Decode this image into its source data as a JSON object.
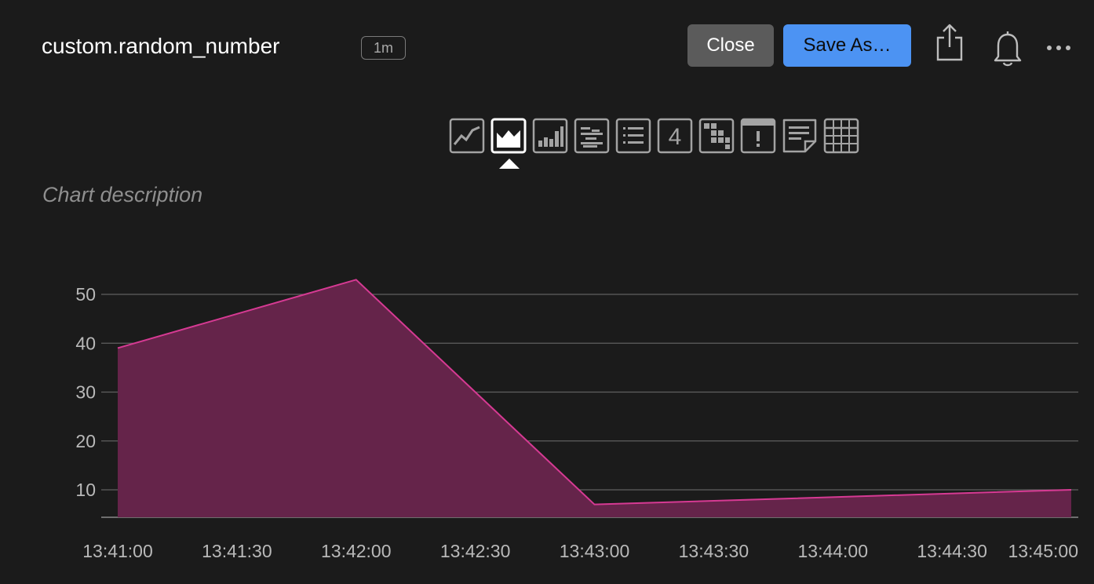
{
  "header": {
    "title": "custom.random_number",
    "interval": "1m",
    "close_label": "Close",
    "save_label": "Save As…"
  },
  "viz_types": [
    {
      "name": "line-chart-icon",
      "selected": false
    },
    {
      "name": "area-chart-icon",
      "selected": true
    },
    {
      "name": "bar-chart-icon",
      "selected": false
    },
    {
      "name": "stacked-chart-icon",
      "selected": false
    },
    {
      "name": "list-icon",
      "selected": false
    },
    {
      "name": "single-value-icon",
      "selected": false,
      "text": "4"
    },
    {
      "name": "heatmap-icon",
      "selected": false
    },
    {
      "name": "event-feed-icon",
      "selected": false
    },
    {
      "name": "text-note-icon",
      "selected": false
    },
    {
      "name": "table-icon",
      "selected": false
    }
  ],
  "description": "Chart description",
  "colors": {
    "series_line": "#d63a93",
    "series_fill": "#65244a",
    "grid": "#5f5f5f",
    "background": "#1b1b1b",
    "primary_button": "#4c93f3"
  },
  "chart_data": {
    "type": "area",
    "x": [
      "13:41:00",
      "13:42:00",
      "13:43:00",
      "13:45:00"
    ],
    "series": [
      {
        "values": [
          39,
          53,
          7,
          10
        ]
      }
    ],
    "xticks": [
      "13:41:00",
      "13:41:30",
      "13:42:00",
      "13:42:30",
      "13:43:00",
      "13:43:30",
      "13:44:00",
      "13:44:30",
      "13:45:00"
    ],
    "yticks": [
      10,
      20,
      30,
      40,
      50
    ],
    "ylim": [
      4.3,
      55
    ],
    "grid": true,
    "legend": "none"
  }
}
